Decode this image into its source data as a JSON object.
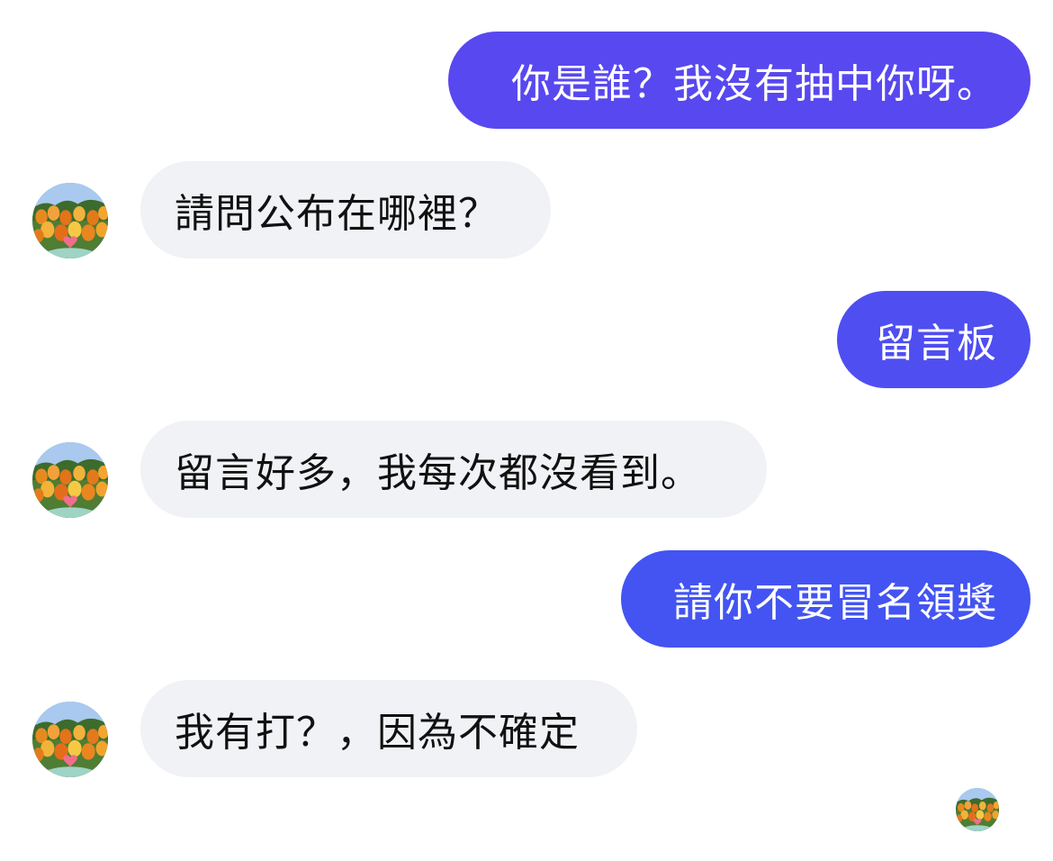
{
  "colors": {
    "sent_top": "#5b4af0",
    "sent_bottom": "#3f55f2",
    "received": "#f0f2f5"
  },
  "messages": [
    {
      "direction": "sent",
      "text": "你是誰？我沒有抽中你呀。"
    },
    {
      "direction": "received",
      "text": "請問公布在哪裡？",
      "avatar": "tulip-avatar"
    },
    {
      "direction": "sent",
      "text": "留言板"
    },
    {
      "direction": "received",
      "text": "留言好多，我每次都沒看到。",
      "avatar": "tulip-avatar"
    },
    {
      "direction": "sent",
      "text": "請你不要冒名領獎"
    },
    {
      "direction": "received",
      "text": "我有打？，因為不確定",
      "avatar": "tulip-avatar"
    }
  ],
  "read_receipt": {
    "icon": "tulip-avatar"
  }
}
